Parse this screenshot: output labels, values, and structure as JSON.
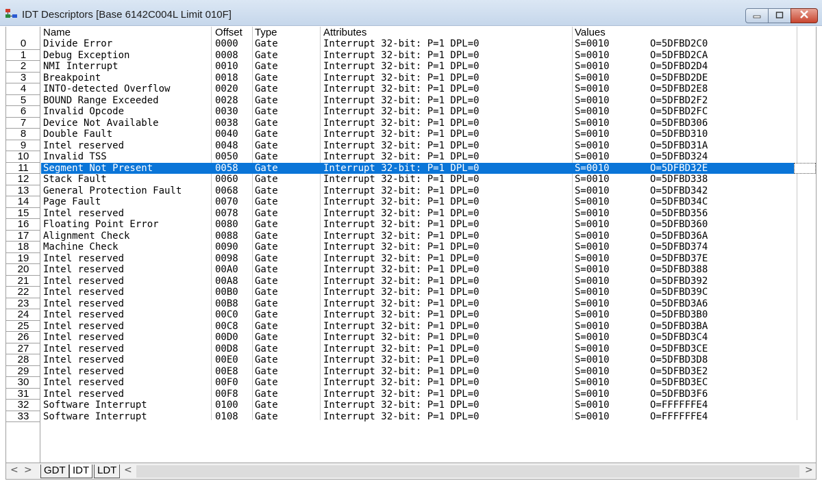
{
  "window": {
    "title": "IDT Descriptors [Base 6142C004L Limit 010F]",
    "accent": "#0a75d8"
  },
  "columns": {
    "name": "Name",
    "offset": "Offset",
    "type": "Type",
    "attributes": "Attributes",
    "values": "Values"
  },
  "selected_index": 11,
  "rows": [
    {
      "num": "0",
      "name": "Divide Error",
      "offset": "0000",
      "type": "Gate",
      "attr": "Interrupt 32-bit: P=1 DPL=0",
      "s": "S=0010",
      "o": "O=5DFBD2C0"
    },
    {
      "num": "1",
      "name": "Debug Exception",
      "offset": "0008",
      "type": "Gate",
      "attr": "Interrupt 32-bit: P=1 DPL=0",
      "s": "S=0010",
      "o": "O=5DFBD2CA"
    },
    {
      "num": "2",
      "name": "NMI Interrupt",
      "offset": "0010",
      "type": "Gate",
      "attr": "Interrupt 32-bit: P=1 DPL=0",
      "s": "S=0010",
      "o": "O=5DFBD2D4"
    },
    {
      "num": "3",
      "name": "Breakpoint",
      "offset": "0018",
      "type": "Gate",
      "attr": "Interrupt 32-bit: P=1 DPL=0",
      "s": "S=0010",
      "o": "O=5DFBD2DE"
    },
    {
      "num": "4",
      "name": "INTO-detected Overflow",
      "offset": "0020",
      "type": "Gate",
      "attr": "Interrupt 32-bit: P=1 DPL=0",
      "s": "S=0010",
      "o": "O=5DFBD2E8"
    },
    {
      "num": "5",
      "name": "BOUND Range Exceeded",
      "offset": "0028",
      "type": "Gate",
      "attr": "Interrupt 32-bit: P=1 DPL=0",
      "s": "S=0010",
      "o": "O=5DFBD2F2"
    },
    {
      "num": "6",
      "name": "Invalid Opcode",
      "offset": "0030",
      "type": "Gate",
      "attr": "Interrupt 32-bit: P=1 DPL=0",
      "s": "S=0010",
      "o": "O=5DFBD2FC"
    },
    {
      "num": "7",
      "name": "Device Not Available",
      "offset": "0038",
      "type": "Gate",
      "attr": "Interrupt 32-bit: P=1 DPL=0",
      "s": "S=0010",
      "o": "O=5DFBD306"
    },
    {
      "num": "8",
      "name": "Double Fault",
      "offset": "0040",
      "type": "Gate",
      "attr": "Interrupt 32-bit: P=1 DPL=0",
      "s": "S=0010",
      "o": "O=5DFBD310"
    },
    {
      "num": "9",
      "name": "Intel reserved",
      "offset": "0048",
      "type": "Gate",
      "attr": "Interrupt 32-bit: P=1 DPL=0",
      "s": "S=0010",
      "o": "O=5DFBD31A"
    },
    {
      "num": "10",
      "name": "Invalid TSS",
      "offset": "0050",
      "type": "Gate",
      "attr": "Interrupt 32-bit: P=1 DPL=0",
      "s": "S=0010",
      "o": "O=5DFBD324"
    },
    {
      "num": "11",
      "name": "Segment Not Present",
      "offset": "0058",
      "type": "Gate",
      "attr": "Interrupt 32-bit: P=1 DPL=0",
      "s": "S=0010",
      "o": "O=5DFBD32E"
    },
    {
      "num": "12",
      "name": "Stack Fault",
      "offset": "0060",
      "type": "Gate",
      "attr": "Interrupt 32-bit: P=1 DPL=0",
      "s": "S=0010",
      "o": "O=5DFBD338"
    },
    {
      "num": "13",
      "name": "General Protection Fault",
      "offset": "0068",
      "type": "Gate",
      "attr": "Interrupt 32-bit: P=1 DPL=0",
      "s": "S=0010",
      "o": "O=5DFBD342"
    },
    {
      "num": "14",
      "name": "Page Fault",
      "offset": "0070",
      "type": "Gate",
      "attr": "Interrupt 32-bit: P=1 DPL=0",
      "s": "S=0010",
      "o": "O=5DFBD34C"
    },
    {
      "num": "15",
      "name": "Intel reserved",
      "offset": "0078",
      "type": "Gate",
      "attr": "Interrupt 32-bit: P=1 DPL=0",
      "s": "S=0010",
      "o": "O=5DFBD356"
    },
    {
      "num": "16",
      "name": "Floating Point Error",
      "offset": "0080",
      "type": "Gate",
      "attr": "Interrupt 32-bit: P=1 DPL=0",
      "s": "S=0010",
      "o": "O=5DFBD360"
    },
    {
      "num": "17",
      "name": "Alignment Check",
      "offset": "0088",
      "type": "Gate",
      "attr": "Interrupt 32-bit: P=1 DPL=0",
      "s": "S=0010",
      "o": "O=5DFBD36A"
    },
    {
      "num": "18",
      "name": "Machine Check",
      "offset": "0090",
      "type": "Gate",
      "attr": "Interrupt 32-bit: P=1 DPL=0",
      "s": "S=0010",
      "o": "O=5DFBD374"
    },
    {
      "num": "19",
      "name": "Intel reserved",
      "offset": "0098",
      "type": "Gate",
      "attr": "Interrupt 32-bit: P=1 DPL=0",
      "s": "S=0010",
      "o": "O=5DFBD37E"
    },
    {
      "num": "20",
      "name": "Intel reserved",
      "offset": "00A0",
      "type": "Gate",
      "attr": "Interrupt 32-bit: P=1 DPL=0",
      "s": "S=0010",
      "o": "O=5DFBD388"
    },
    {
      "num": "21",
      "name": "Intel reserved",
      "offset": "00A8",
      "type": "Gate",
      "attr": "Interrupt 32-bit: P=1 DPL=0",
      "s": "S=0010",
      "o": "O=5DFBD392"
    },
    {
      "num": "22",
      "name": "Intel reserved",
      "offset": "00B0",
      "type": "Gate",
      "attr": "Interrupt 32-bit: P=1 DPL=0",
      "s": "S=0010",
      "o": "O=5DFBD39C"
    },
    {
      "num": "23",
      "name": "Intel reserved",
      "offset": "00B8",
      "type": "Gate",
      "attr": "Interrupt 32-bit: P=1 DPL=0",
      "s": "S=0010",
      "o": "O=5DFBD3A6"
    },
    {
      "num": "24",
      "name": "Intel reserved",
      "offset": "00C0",
      "type": "Gate",
      "attr": "Interrupt 32-bit: P=1 DPL=0",
      "s": "S=0010",
      "o": "O=5DFBD3B0"
    },
    {
      "num": "25",
      "name": "Intel reserved",
      "offset": "00C8",
      "type": "Gate",
      "attr": "Interrupt 32-bit: P=1 DPL=0",
      "s": "S=0010",
      "o": "O=5DFBD3BA"
    },
    {
      "num": "26",
      "name": "Intel reserved",
      "offset": "00D0",
      "type": "Gate",
      "attr": "Interrupt 32-bit: P=1 DPL=0",
      "s": "S=0010",
      "o": "O=5DFBD3C4"
    },
    {
      "num": "27",
      "name": "Intel reserved",
      "offset": "00D8",
      "type": "Gate",
      "attr": "Interrupt 32-bit: P=1 DPL=0",
      "s": "S=0010",
      "o": "O=5DFBD3CE"
    },
    {
      "num": "28",
      "name": "Intel reserved",
      "offset": "00E0",
      "type": "Gate",
      "attr": "Interrupt 32-bit: P=1 DPL=0",
      "s": "S=0010",
      "o": "O=5DFBD3D8"
    },
    {
      "num": "29",
      "name": "Intel reserved",
      "offset": "00E8",
      "type": "Gate",
      "attr": "Interrupt 32-bit: P=1 DPL=0",
      "s": "S=0010",
      "o": "O=5DFBD3E2"
    },
    {
      "num": "30",
      "name": "Intel reserved",
      "offset": "00F0",
      "type": "Gate",
      "attr": "Interrupt 32-bit: P=1 DPL=0",
      "s": "S=0010",
      "o": "O=5DFBD3EC"
    },
    {
      "num": "31",
      "name": "Intel reserved",
      "offset": "00F8",
      "type": "Gate",
      "attr": "Interrupt 32-bit: P=1 DPL=0",
      "s": "S=0010",
      "o": "O=5DFBD3F6"
    },
    {
      "num": "32",
      "name": "Software Interrupt",
      "offset": "0100",
      "type": "Gate",
      "attr": "Interrupt 32-bit: P=1 DPL=0",
      "s": "S=0010",
      "o": "O=FFFFFFE4"
    },
    {
      "num": "33",
      "name": "Software Interrupt",
      "offset": "0108",
      "type": "Gate",
      "attr": "Interrupt 32-bit: P=1 DPL=0",
      "s": "S=0010",
      "o": "O=FFFFFFE4"
    }
  ],
  "tabs": [
    {
      "label": "GDT"
    },
    {
      "label": "IDT"
    },
    {
      "label": "LDT"
    }
  ],
  "tabs_active": "IDT",
  "icons": {
    "app": "table-window-icon",
    "minimize": "minimize-icon",
    "maximize": "maximize-icon",
    "close": "close-icon",
    "prev": "chevron-left-icon",
    "next": "chevron-right-icon"
  }
}
